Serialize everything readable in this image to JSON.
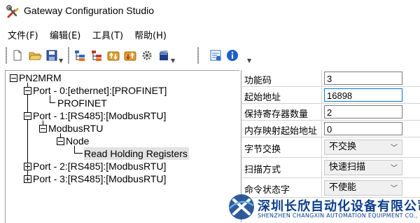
{
  "window": {
    "title": "Gateway Configuration Studio",
    "icon": "tools-icon"
  },
  "menu": [
    {
      "label": "文件(F)"
    },
    {
      "label": "编辑(E)"
    },
    {
      "label": "工具(T)"
    },
    {
      "label": "帮助(H)"
    }
  ],
  "toolbar": {
    "icons": [
      "new-file-icon",
      "open-folder-icon",
      "save-icon",
      "add-port-icon",
      "add-node-icon",
      "upload-icon",
      "download-icon",
      "settings-icon",
      "book-icon",
      "debug-icon",
      "info-icon"
    ]
  },
  "tree": {
    "root": "PN2MRM",
    "port0": "Port - 0:[ethernet]:[PROFINET]",
    "profinet": "PROFINET",
    "port1": "Port - 1:[RS485]:[ModbusRTU]",
    "modbusrtu": "ModbusRTU",
    "node": "Node",
    "command": "Read Holding Registers",
    "port2": "Port - 2:[RS485]:[ModbusRTU]",
    "port3": "Port - 3:[RS485]:[ModbusRTU]",
    "selected": "Read Holding Registers"
  },
  "properties": {
    "function_code": {
      "label": "功能码",
      "value": "3"
    },
    "start_address": {
      "label": "起始地址",
      "value": "16898"
    },
    "register_count": {
      "label": "保持寄存器数量",
      "value": "2"
    },
    "memory_start": {
      "label": "内存映射起始地址",
      "value": "0"
    },
    "byte_swap": {
      "label": "字节交换",
      "value": "不交换"
    },
    "scan_mode": {
      "label": "扫描方式",
      "value": "快速扫描"
    },
    "cmd_status": {
      "label": "命令状态字",
      "value": "不使能"
    }
  },
  "watermark": {
    "cn": "深圳长欣自动化设备有限公司",
    "en": "SHENZHEN CHANGXIN AUTOMATION EQUIPMENT CO., LTD"
  },
  "colors": {
    "accent": "#0078d7",
    "watermark": "#0a3e8a"
  }
}
